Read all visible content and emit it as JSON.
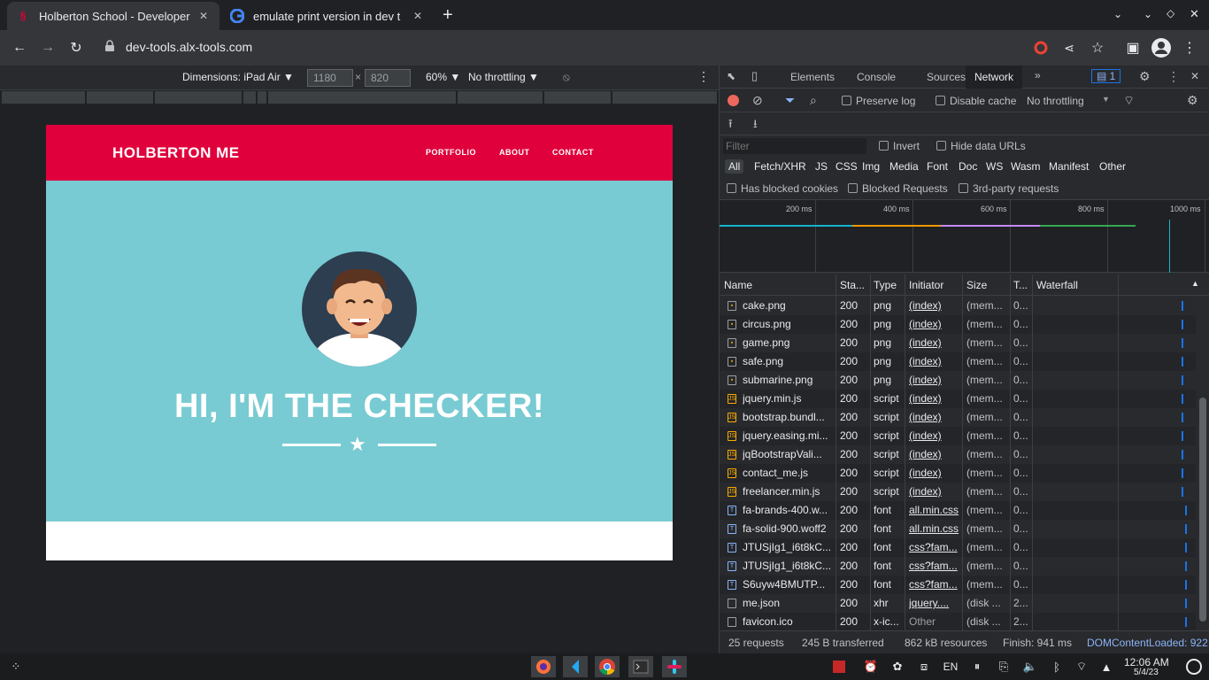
{
  "browser": {
    "tabs": [
      {
        "title": "Holberton School - Developer",
        "favicon": "holberton-icon"
      },
      {
        "title": "emulate print version in dev t",
        "favicon": "google-icon"
      }
    ],
    "url": "dev-tools.alx-tools.com",
    "new_tab_label": "+"
  },
  "device_toolbar": {
    "dimensions_label": "Dimensions: iPad Air ▼",
    "width": "1180",
    "times": "×",
    "height": "820",
    "zoom": "60% ▼",
    "throttle": "No throttling ▼"
  },
  "site": {
    "brand": "HOLBERTON ME",
    "nav": [
      "PORTFOLIO",
      "ABOUT",
      "CONTACT"
    ],
    "hero_title": "HI, I'M THE CHECKER!",
    "star": "★"
  },
  "devtools": {
    "tabs": [
      "Elements",
      "Console",
      "Sources",
      "Network"
    ],
    "selected_tab": "Network",
    "badge": "1",
    "preserve_log": "Preserve log",
    "disable_cache": "Disable cache",
    "throttling": "No throttling",
    "filter_placeholder": "Filter",
    "invert": "Invert",
    "hide_data_urls": "Hide data URLs",
    "types": [
      "All",
      "Fetch/XHR",
      "JS",
      "CSS",
      "Img",
      "Media",
      "Font",
      "Doc",
      "WS",
      "Wasm",
      "Manifest",
      "Other"
    ],
    "has_blocked_cookies": "Has blocked cookies",
    "blocked_requests": "Blocked Requests",
    "third_party": "3rd-party requests",
    "overview_ticks": [
      "200 ms",
      "400 ms",
      "600 ms",
      "800 ms",
      "1000 ms"
    ],
    "columns": [
      "Name",
      "Sta...",
      "Type",
      "Initiator",
      "Size",
      "T...",
      "Waterfall"
    ],
    "rows": [
      {
        "name": "cake.png",
        "status": "200",
        "type": "png",
        "initiator": "(index)",
        "size": "(mem...",
        "time": "0..."
      },
      {
        "name": "circus.png",
        "status": "200",
        "type": "png",
        "initiator": "(index)",
        "size": "(mem...",
        "time": "0..."
      },
      {
        "name": "game.png",
        "status": "200",
        "type": "png",
        "initiator": "(index)",
        "size": "(mem...",
        "time": "0..."
      },
      {
        "name": "safe.png",
        "status": "200",
        "type": "png",
        "initiator": "(index)",
        "size": "(mem...",
        "time": "0..."
      },
      {
        "name": "submarine.png",
        "status": "200",
        "type": "png",
        "initiator": "(index)",
        "size": "(mem...",
        "time": "0..."
      },
      {
        "name": "jquery.min.js",
        "status": "200",
        "type": "script",
        "initiator": "(index)",
        "size": "(mem...",
        "time": "0..."
      },
      {
        "name": "bootstrap.bundl...",
        "status": "200",
        "type": "script",
        "initiator": "(index)",
        "size": "(mem...",
        "time": "0..."
      },
      {
        "name": "jquery.easing.mi...",
        "status": "200",
        "type": "script",
        "initiator": "(index)",
        "size": "(mem...",
        "time": "0..."
      },
      {
        "name": "jqBootstrapVali...",
        "status": "200",
        "type": "script",
        "initiator": "(index)",
        "size": "(mem...",
        "time": "0..."
      },
      {
        "name": "contact_me.js",
        "status": "200",
        "type": "script",
        "initiator": "(index)",
        "size": "(mem...",
        "time": "0..."
      },
      {
        "name": "freelancer.min.js",
        "status": "200",
        "type": "script",
        "initiator": "(index)",
        "size": "(mem...",
        "time": "0..."
      },
      {
        "name": "fa-brands-400.w...",
        "status": "200",
        "type": "font",
        "initiator": "all.min.css",
        "size": "(mem...",
        "time": "0..."
      },
      {
        "name": "fa-solid-900.woff2",
        "status": "200",
        "type": "font",
        "initiator": "all.min.css",
        "size": "(mem...",
        "time": "0..."
      },
      {
        "name": "JTUSjIg1_i6t8kC...",
        "status": "200",
        "type": "font",
        "initiator": "css?fam...",
        "size": "(mem...",
        "time": "0..."
      },
      {
        "name": "JTUSjIg1_i6t8kC...",
        "status": "200",
        "type": "font",
        "initiator": "css?fam...",
        "size": "(mem...",
        "time": "0..."
      },
      {
        "name": "S6uyw4BMUTP...",
        "status": "200",
        "type": "font",
        "initiator": "css?fam...",
        "size": "(mem...",
        "time": "0..."
      },
      {
        "name": "me.json",
        "status": "200",
        "type": "xhr",
        "initiator": "jquery....",
        "size": "(disk ...",
        "time": "2..."
      },
      {
        "name": "favicon.ico",
        "status": "200",
        "type": "x-ic...",
        "initiator": "Other",
        "size": "(disk ...",
        "time": "2..."
      }
    ],
    "status_bar": {
      "requests": "25 requests",
      "transferred": "245 B transferred",
      "resources": "862 kB resources",
      "finish": "Finish: 941 ms",
      "dcl": "DOMContentLoaded: 922"
    }
  },
  "taskbar": {
    "lang": "EN",
    "time": "12:06 AM",
    "date": "5/4/23"
  },
  "colors": {
    "brand_red": "#e0003c",
    "hero_teal": "#78cbd2",
    "devtools_bg": "#292a2d"
  }
}
